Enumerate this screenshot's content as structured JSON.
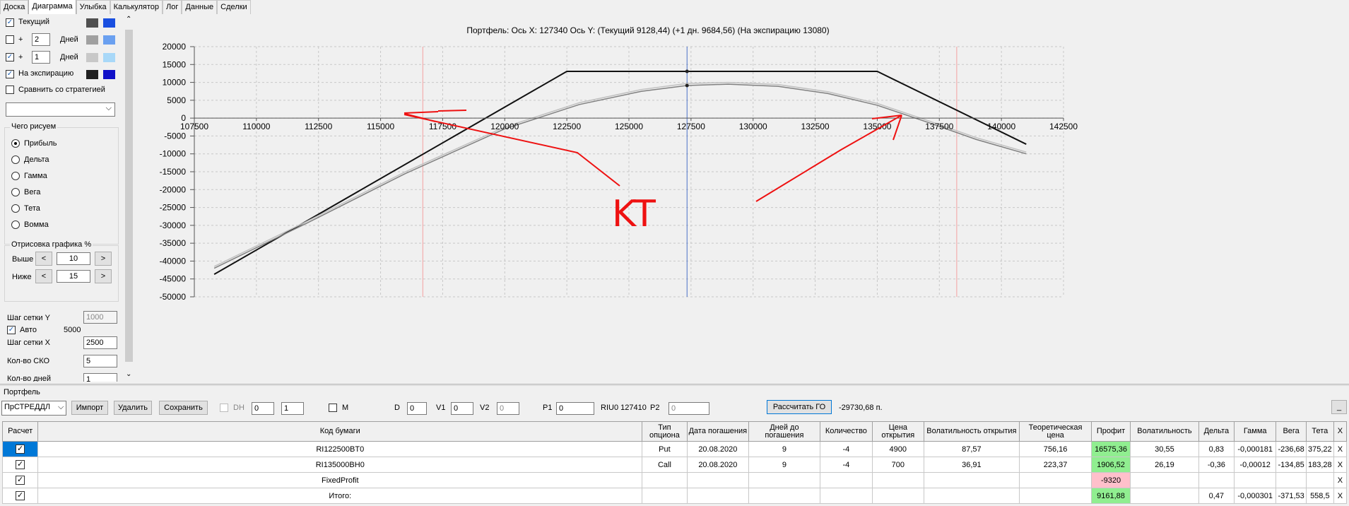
{
  "tabs": [
    "Доска",
    "Диаграмма",
    "Улыбка",
    "Калькулятор",
    "Лог",
    "Данные",
    "Сделки"
  ],
  "left_panel": {
    "current_label": "Текущий",
    "plus_label": "+",
    "days_label": "Дней",
    "days_value_1": "2",
    "days_value_2": "1",
    "expiry_label": "На экспирацию",
    "compare_label": "Сравнить со стратегией",
    "what_draw_label": "Чего рисуем",
    "radios": [
      "Прибыль",
      "Дельта",
      "Гамма",
      "Вега",
      "Тета",
      "Вомма"
    ],
    "render_label": "Отрисовка графика %",
    "above_label": "Выше",
    "above_value": "10",
    "below_label": "Ниже",
    "below_value": "15",
    "prev_btn": "<",
    "next_btn": ">",
    "grid_y_label": "Шаг сетки Y",
    "grid_y_value": "1000",
    "auto_label": "Авто",
    "auto_value": "5000",
    "grid_x_label": "Шаг сетки X",
    "grid_x_value": "2500",
    "sko_label": "Кол-во СКО",
    "sko_value": "5",
    "days_count_label": "Кол-во дней",
    "days_count_value": "1",
    "colors": {
      "current_a": "#505050",
      "current_b": "#1a4fe0",
      "days2_a": "#a0a0a0",
      "days2_b": "#6aa0f0",
      "days1_a": "#c8c8c8",
      "days1_b": "#a8d8f8",
      "expiry_a": "#202020",
      "expiry_b": "#1010c8"
    }
  },
  "chart_title": "Портфель: Ось X: 127340 Ось Y:  (Текущий 9128,44)  (+1 дн. 9684,56)  (На экспирацию 13080)",
  "annotation_text": "KT",
  "chart_data": {
    "type": "line",
    "title": "Портфель: Ось X: 127340 Ось Y:  (Текущий 9128,44)  (+1 дн. 9684,56)  (На экспирацию 13080)",
    "xlim": [
      107500,
      142500
    ],
    "ylim": [
      -50000,
      20000
    ],
    "x_ticks": [
      "107500",
      "110000",
      "112500",
      "115000",
      "117500",
      "120000",
      "122500",
      "125000",
      "127500",
      "130000",
      "132500",
      "135000",
      "137500",
      "140000",
      "142500"
    ],
    "y_ticks": [
      "20000",
      "15000",
      "10000",
      "5000",
      "0",
      "-5000",
      "-10000",
      "-15000",
      "-20000",
      "-25000",
      "-30000",
      "-35000",
      "-40000",
      "-45000",
      "-50000"
    ],
    "cursor_x": 127340,
    "vertical_lines": [
      116700,
      138200
    ],
    "series": [
      {
        "color": "#111111",
        "x": [
          108300,
          122500,
          135000,
          141000
        ],
        "y": [
          -43700,
          13080,
          13080,
          -7300
        ]
      },
      {
        "color": "#808080",
        "x": [
          108300,
          112000,
          116000,
          120000,
          123000,
          125500,
          127340,
          129000,
          131000,
          133000,
          135000,
          137000,
          139000,
          141000
        ],
        "y": [
          -42000,
          -29500,
          -15500,
          -3000,
          3800,
          7500,
          9128,
          9500,
          8900,
          6900,
          3600,
          -1100,
          -6000,
          -10000
        ]
      },
      {
        "color": "#c0c0c0",
        "x": [
          108300,
          112000,
          116000,
          120000,
          123000,
          125500,
          127340,
          129000,
          131000,
          133000,
          135000,
          137000,
          139000,
          141000
        ],
        "y": [
          -41500,
          -29000,
          -15000,
          -2500,
          4300,
          8000,
          9684,
          10000,
          9400,
          7400,
          4100,
          -600,
          -5500,
          -9500
        ]
      }
    ],
    "markers": [
      {
        "x": 127340,
        "y": 13080
      },
      {
        "x": 127340,
        "y": 9128
      }
    ]
  },
  "portfolio": {
    "label": "Портфель",
    "name": "ПрСТРЕДДЛ",
    "import_btn": "Импорт",
    "delete_btn": "Удалить",
    "save_btn": "Сохранить",
    "dh_label": "DH",
    "dh_v1": "0",
    "dh_v2": "1",
    "m_label": "M",
    "d_label": "D",
    "d_value": "0",
    "v1_label": "V1",
    "v1_value": "0",
    "v2_label": "V2",
    "v2_value": "0",
    "p1_label": "P1",
    "p1_value": "0",
    "riu_label": "RIU0 127410",
    "p2_label": "P2",
    "p2_value": "0",
    "calc_btn": "Рассчитать ГО",
    "go_value": "-29730,68 п.",
    "minimize": "_"
  },
  "table": {
    "headers": [
      "Расчет",
      "Код бумаги",
      "Тип опциона",
      "Дата погашения",
      "Дней до погашения",
      "Количество",
      "Цена открытия",
      "Волатильность открытия",
      "Теоретическая цена",
      "Профит",
      "Волатильность",
      "Дельта",
      "Гамма",
      "Вега",
      "Тета",
      "X"
    ],
    "rows": [
      [
        "✓",
        "RI122500BT0",
        "Put",
        "20.08.2020",
        "9",
        "-4",
        "4900",
        "87,57",
        "756,16",
        "16575,36",
        "30,55",
        "0,83",
        "-0,000181",
        "-236,68",
        "375,22",
        "X"
      ],
      [
        "✓",
        "RI135000BH0",
        "Call",
        "20.08.2020",
        "9",
        "-4",
        "700",
        "36,91",
        "223,37",
        "1906,52",
        "26,19",
        "-0,36",
        "-0,00012",
        "-134,85",
        "183,28",
        "X"
      ],
      [
        "✓",
        "FixedProfit",
        "",
        "",
        "",
        "",
        "",
        "",
        "",
        "-9320",
        "",
        "",
        "",
        "",
        "",
        "X"
      ],
      [
        "✓",
        "Итого:",
        "",
        "",
        "",
        "",
        "",
        "",
        "",
        "9161,88",
        "",
        "0,47",
        "-0,000301",
        "-371,53",
        "558,5",
        "X"
      ]
    ]
  }
}
